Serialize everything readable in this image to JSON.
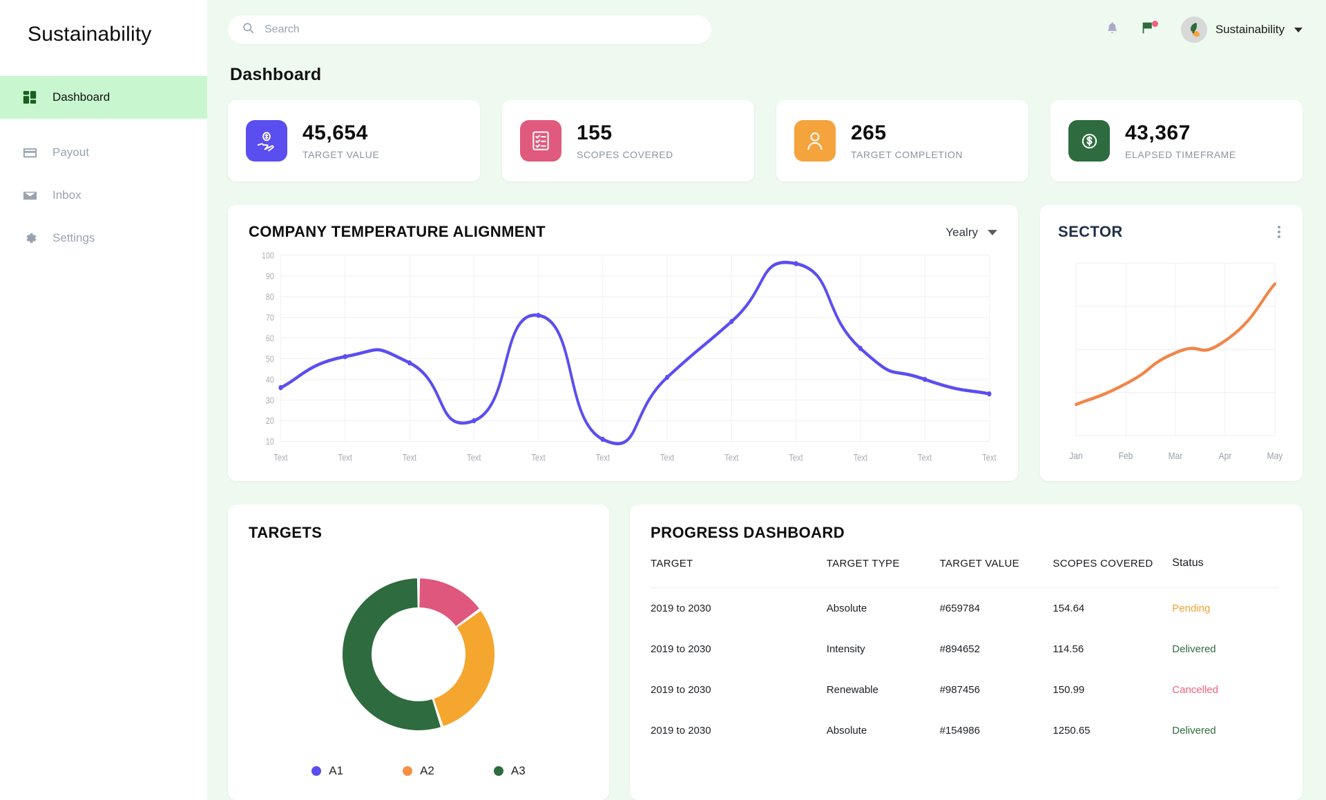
{
  "brand": {
    "name": "Sustainability"
  },
  "sidebar": {
    "items": [
      {
        "label": "Dashboard",
        "icon": "grid-icon",
        "active": true
      },
      {
        "label": "Payout",
        "icon": "card-icon",
        "active": false
      },
      {
        "label": "Inbox",
        "icon": "mail-icon",
        "active": false
      },
      {
        "label": "Settings",
        "icon": "gear-icon",
        "active": false
      }
    ]
  },
  "topbar": {
    "search_placeholder": "Search",
    "search_value": "",
    "notifications_icon": "bell-icon",
    "flag_icon": "flag-icon",
    "flag_has_badge": true,
    "profile_name": "Sustainability",
    "avatar_icon": "leaf-logo-avatar"
  },
  "page": {
    "title": "Dashboard"
  },
  "stats": [
    {
      "value": "45,654",
      "label": "TARGET VALUE",
      "icon": "hand-coin-icon",
      "color": "#5a4ef0"
    },
    {
      "value": "155",
      "label": "SCOPES COVERED",
      "icon": "checklist-icon",
      "color": "#e05a7d"
    },
    {
      "value": "265",
      "label": "TARGET COMPLETION",
      "icon": "user-icon",
      "color": "#f5a33c"
    },
    {
      "value": "43,367",
      "label": "ELAPSED TIMEFRAME",
      "icon": "dollar-circle-icon",
      "color": "#2e6b3e"
    }
  ],
  "temperature_card": {
    "title": "COMPANY TEMPERATURE ALIGNMENT",
    "period_label": "Yealry"
  },
  "sector_card": {
    "title": "SECTOR",
    "menu_icon": "kebab-menu-icon"
  },
  "targets_card": {
    "title": "TARGETS",
    "legend": [
      {
        "label": "A1",
        "color": "#5a4ef0"
      },
      {
        "label": "A2",
        "color": "#f59042"
      },
      {
        "label": "A3",
        "color": "#2e6b3e"
      }
    ]
  },
  "progress_card": {
    "title": "PROGRESS DASHBOARD",
    "columns": [
      "TARGET",
      "TARGET TYPE",
      "TARGET VALUE",
      "SCOPES COVERED",
      "Status"
    ],
    "rows": [
      {
        "target": "2019 to 2030",
        "type": "Absolute",
        "value": "#659784",
        "scopes": "154.64",
        "status": "Pending",
        "status_color": "#f5a030"
      },
      {
        "target": "2019 to 2030",
        "type": "Intensity",
        "value": "#894652",
        "scopes": "114.56",
        "status": "Delivered",
        "status_color": "#2e6b3e"
      },
      {
        "target": "2019 to 2030",
        "type": "Renewable",
        "value": "#987456",
        "scopes": "150.99",
        "status": "Cancelled",
        "status_color": "#f4607f"
      },
      {
        "target": "2019 to 2030",
        "type": "Absolute",
        "value": "#154986",
        "scopes": "1250.65",
        "status": "Delivered",
        "status_color": "#2e6b3e"
      }
    ]
  },
  "chart_data": [
    {
      "type": "line",
      "title": "COMPANY TEMPERATURE ALIGNMENT",
      "xlabel": "",
      "ylabel": "",
      "ylim": [
        10,
        100
      ],
      "yticks": [
        10,
        20,
        30,
        40,
        50,
        60,
        70,
        80,
        90,
        100
      ],
      "categories": [
        "Text",
        "Text",
        "Text",
        "Text",
        "Text",
        "Text",
        "Text",
        "Text",
        "Text",
        "Text",
        "Text",
        "Text"
      ],
      "values": [
        36,
        51,
        48,
        20,
        71,
        11,
        41,
        68,
        96,
        55,
        40,
        33
      ],
      "series_color": "#5a4ef0",
      "grid": true,
      "legend": "none",
      "markers": true
    },
    {
      "type": "line",
      "title": "SECTOR",
      "xlabel": "",
      "ylabel": "",
      "categories": [
        "Jan",
        "Feb",
        "Mar",
        "Apr",
        "May"
      ],
      "values": [
        18,
        30,
        48,
        55,
        88
      ],
      "ylim": [
        0,
        100
      ],
      "series_color": "#f2854a",
      "grid": true,
      "legend": "none",
      "markers": false
    },
    {
      "type": "pie",
      "title": "TARGETS",
      "labels": [
        "A1",
        "A2",
        "A3"
      ],
      "values": [
        15,
        30,
        55
      ],
      "colors": [
        "#e0577e",
        "#f5a62e",
        "#2e6b3e"
      ],
      "donut": true,
      "legend": "bottom",
      "legend_labels": [
        "A1",
        "A2",
        "A3"
      ],
      "legend_colors": [
        "#5a4ef0",
        "#f59042",
        "#2e6b3e"
      ]
    }
  ]
}
